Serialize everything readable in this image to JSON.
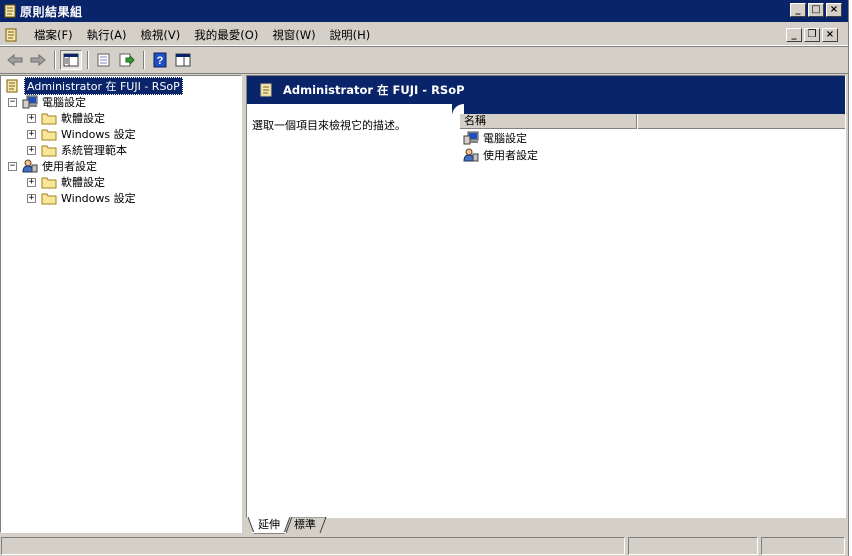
{
  "window": {
    "title": "原則結果組"
  },
  "menu": {
    "items": [
      "檔案(F)",
      "執行(A)",
      "檢視(V)",
      "我的最愛(O)",
      "視窗(W)",
      "說明(H)"
    ]
  },
  "tree": {
    "root": "Administrator 在 FUJI - RSoP",
    "computer": {
      "label": "電腦設定",
      "children": [
        "軟體設定",
        "Windows 設定",
        "系統管理範本"
      ]
    },
    "user": {
      "label": "使用者設定",
      "children": [
        "軟體設定",
        "Windows 設定"
      ]
    }
  },
  "details": {
    "banner_title": "Administrator 在 FUJI - RSoP",
    "description": "選取一個項目來檢視它的描述。",
    "column_name": "名稱",
    "items": [
      "電腦設定",
      "使用者設定"
    ]
  },
  "tabs": {
    "extended": "延伸",
    "standard": "標準"
  },
  "colors": {
    "titlebar": "#0a246a",
    "face": "#d4d0c8",
    "selection": "#0a246a"
  },
  "icons": {
    "app": "scroll-icon",
    "back": "back-arrow-icon",
    "forward": "forward-arrow-icon",
    "computer": "computer-icon",
    "user": "user-icon",
    "folder": "folder-icon"
  }
}
